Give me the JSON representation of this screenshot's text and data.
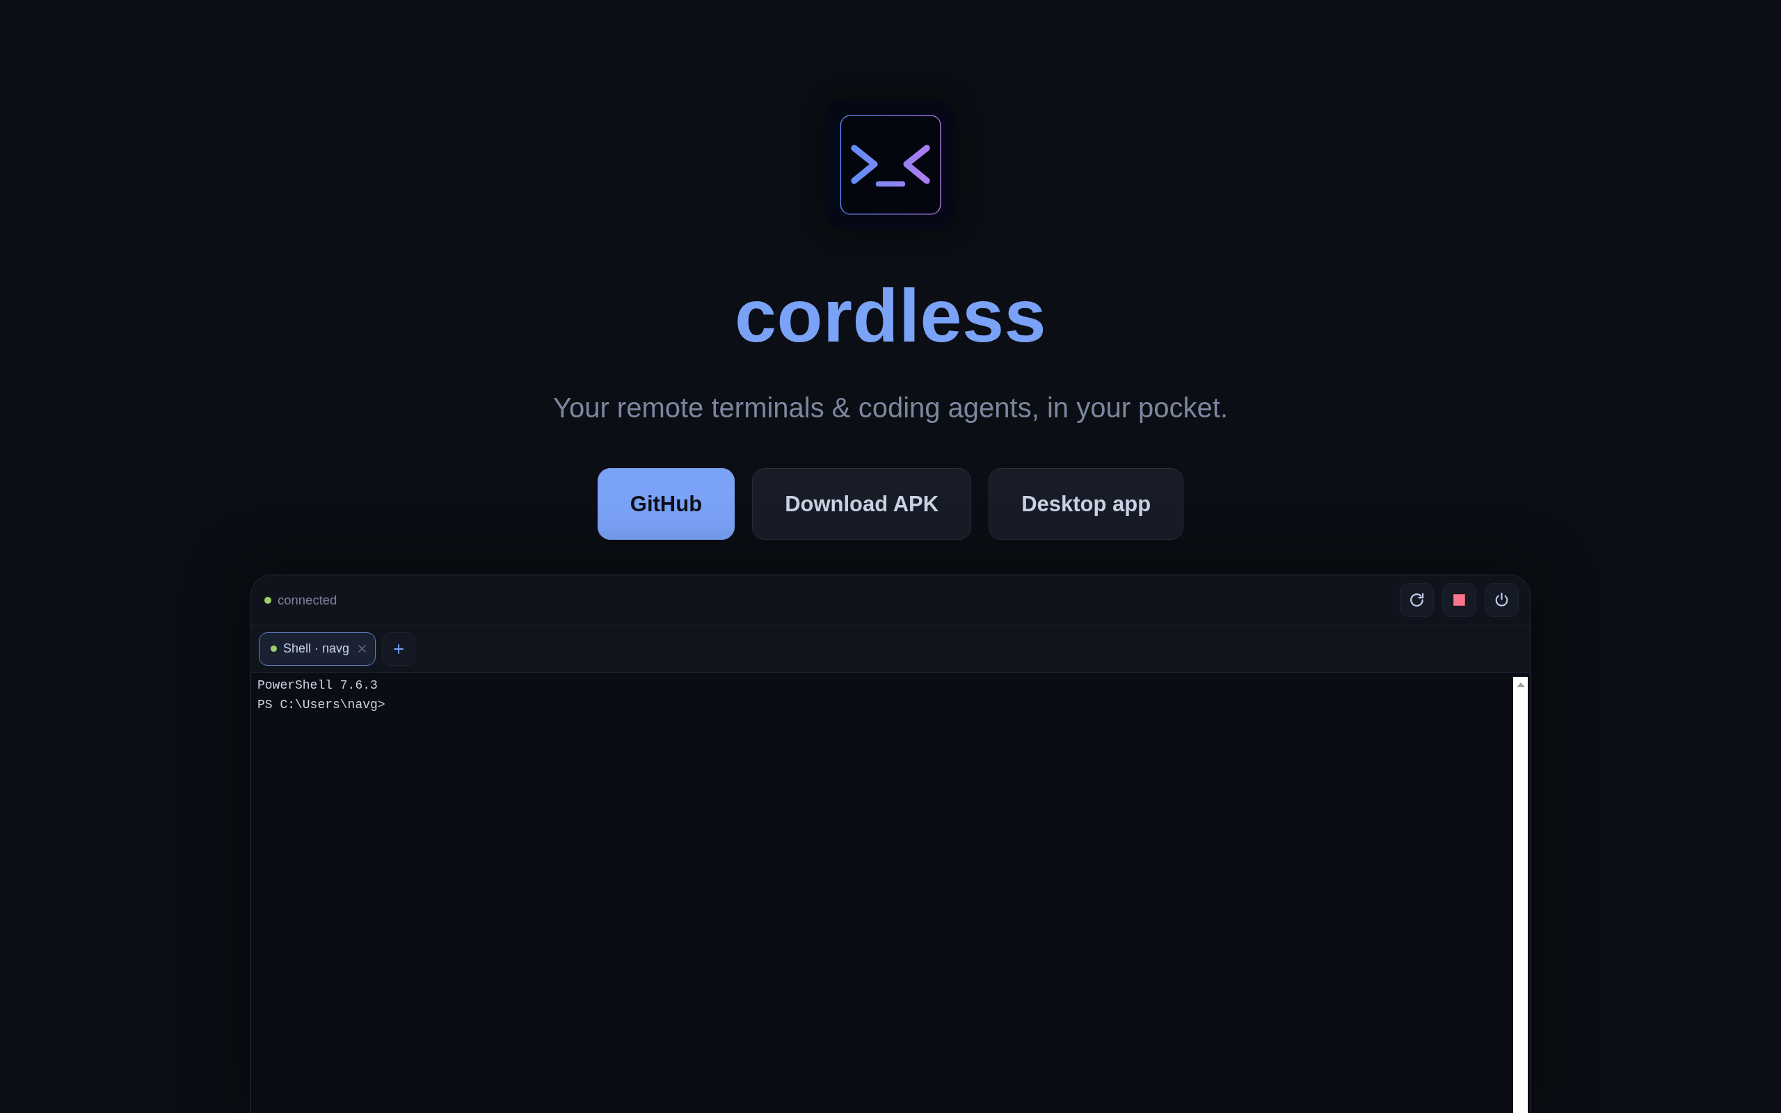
{
  "hero": {
    "title": "cordless",
    "tagline": "Your remote terminals & coding agents, in your pocket.",
    "buttons": [
      {
        "label": "GitHub",
        "kind": "primary"
      },
      {
        "label": "Download APK",
        "kind": "secondary"
      },
      {
        "label": "Desktop app",
        "kind": "secondary"
      }
    ]
  },
  "terminal": {
    "status": {
      "label": "connected",
      "connected": true
    },
    "tabs": [
      {
        "label": "Shell · navg",
        "selected": true,
        "running": true
      }
    ],
    "output": [
      "PowerShell 7.6.3",
      "PS C:\\Users\\navg>"
    ]
  }
}
